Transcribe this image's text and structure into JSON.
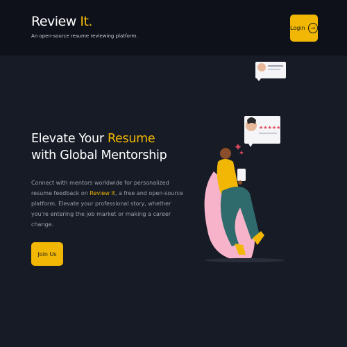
{
  "header": {
    "brand_name": "Review",
    "brand_accent": "It.",
    "tagline": "An open-source resume reviewing platform.",
    "login_label": "Login"
  },
  "hero": {
    "title_part1": "Elevate Your ",
    "title_accent": "Resume",
    "title_part2": " with Global Mentorship",
    "desc_part1": "Connect with mentors worldwide for personalized resume feedback on ",
    "desc_highlight": "Review It",
    "desc_part2": ", a free and open-source platform. Elevate your professional story, whether you're entering the job market or making a career change.",
    "join_label": "Join Us",
    "review_stars": "★★★★★"
  },
  "colors": {
    "accent": "#f2b705",
    "background": "#171b26",
    "header_bg": "#0e111a"
  }
}
